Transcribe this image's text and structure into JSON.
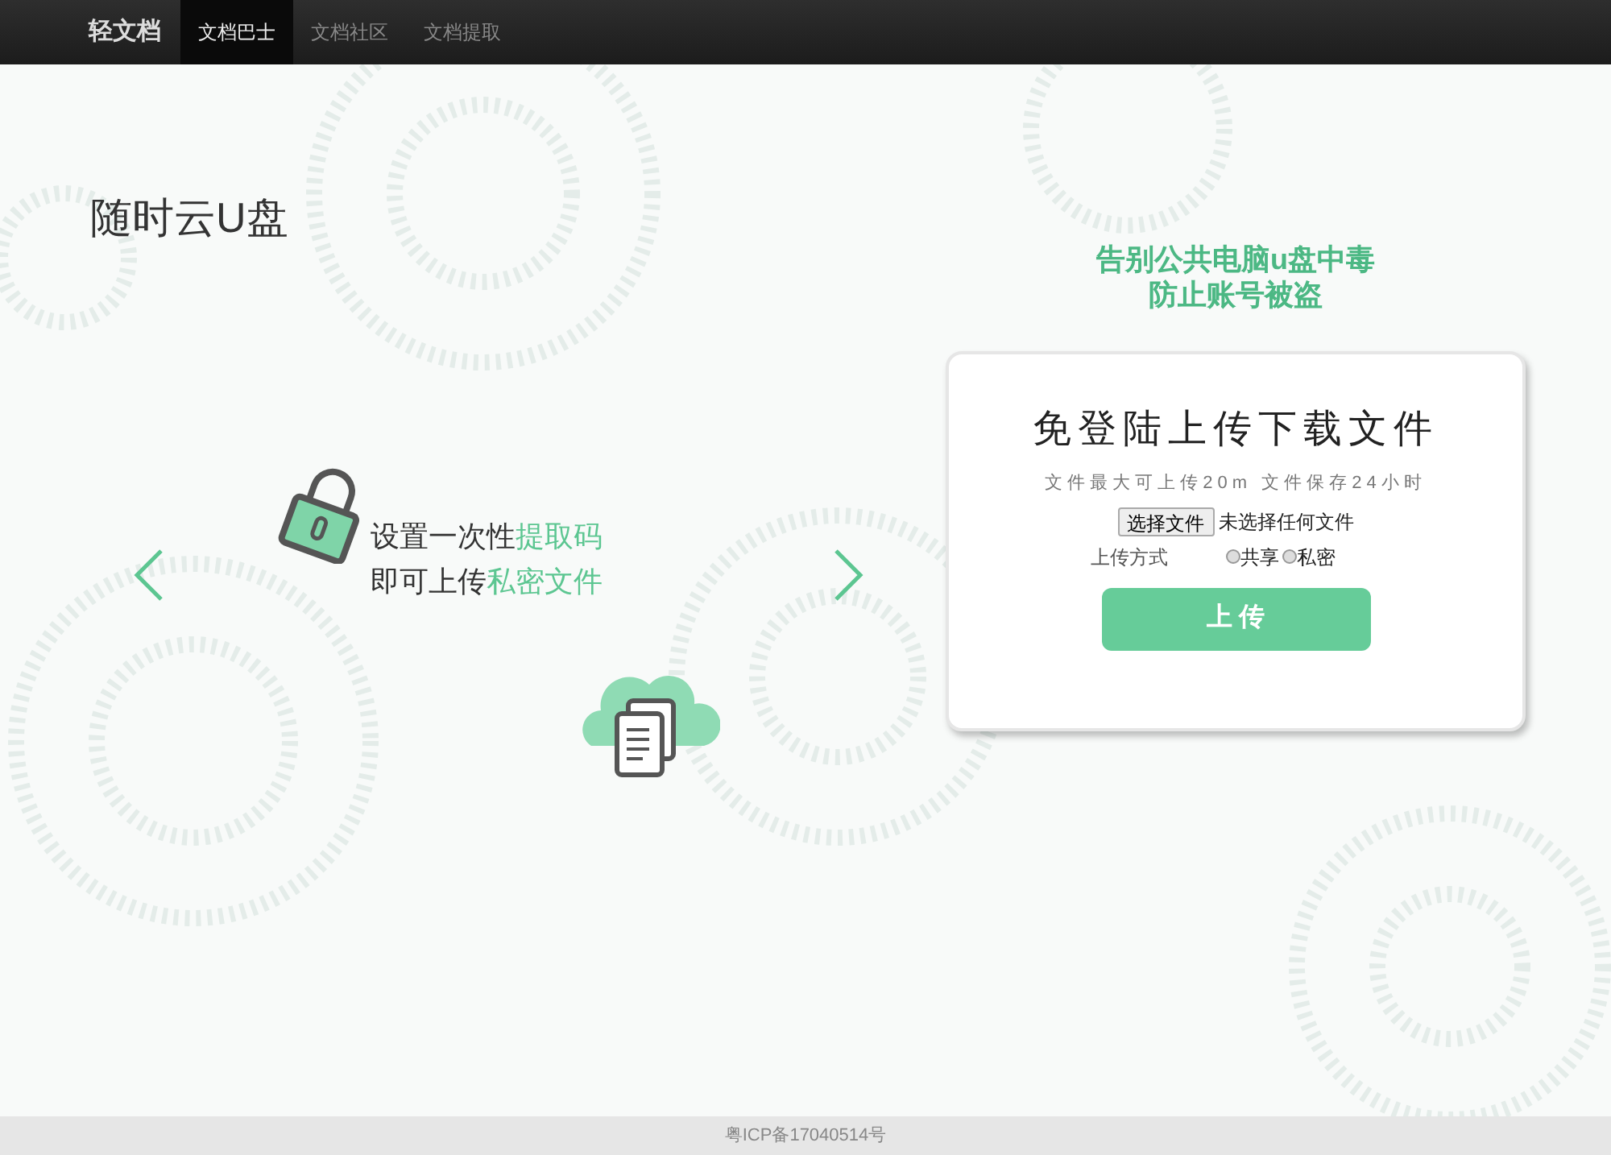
{
  "navbar": {
    "brand": "轻文档",
    "tabs": [
      {
        "label": "文档巴士",
        "selected": true
      },
      {
        "label": "文档社区",
        "selected": false
      },
      {
        "label": "文档提取",
        "selected": false
      }
    ]
  },
  "page_title": "随时云U盘",
  "carousel": {
    "lines": [
      [
        {
          "text": "设置一次性",
          "highlight": false
        },
        {
          "text": "提取码",
          "highlight": true
        }
      ],
      [
        {
          "text": "即可上传",
          "highlight": false
        },
        {
          "text": "私密文件",
          "highlight": true
        }
      ]
    ]
  },
  "slogan": [
    "告别公共电脑u盘中毒",
    "防止账号被盗"
  ],
  "upload_card": {
    "title": "免登陆上传下载文件",
    "info": "文件最大可上传20m 文件保存24小时",
    "file_button": "选择文件",
    "file_status": "未选择任何文件",
    "mode_label": "上传方式",
    "modes": [
      {
        "label": "共享",
        "selected": false
      },
      {
        "label": "私密",
        "selected": false
      }
    ],
    "submit": "上 传"
  },
  "footer": "粤ICP备17040514号"
}
